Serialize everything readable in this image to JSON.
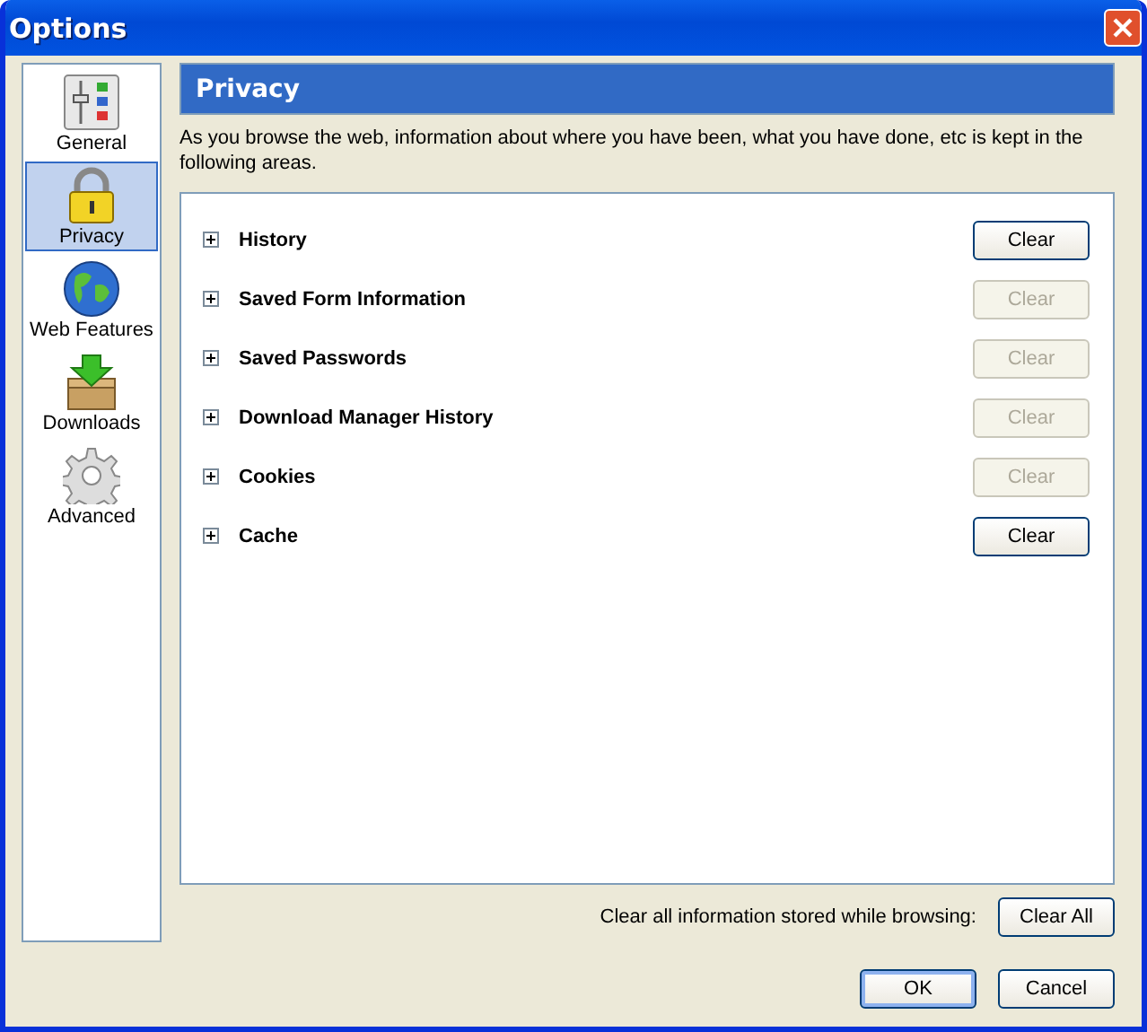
{
  "window": {
    "title": "Options"
  },
  "sidebar": {
    "items": [
      {
        "label": "General",
        "selected": false
      },
      {
        "label": "Privacy",
        "selected": true
      },
      {
        "label": "Web Features",
        "selected": false
      },
      {
        "label": "Downloads",
        "selected": false
      },
      {
        "label": "Advanced",
        "selected": false
      }
    ]
  },
  "panel": {
    "title": "Privacy",
    "description": "As you browse the web, information about where you have been, what you have done, etc is kept in the following areas.",
    "items": [
      {
        "label": "History",
        "expanded": false,
        "button": "Clear",
        "disabled": false
      },
      {
        "label": "Saved Form Information",
        "expanded": false,
        "button": "Clear",
        "disabled": true
      },
      {
        "label": "Saved Passwords",
        "expanded": false,
        "button": "Clear",
        "disabled": true
      },
      {
        "label": "Download Manager History",
        "expanded": false,
        "button": "Clear",
        "disabled": true
      },
      {
        "label": "Cookies",
        "expanded": false,
        "button": "Clear",
        "disabled": true
      },
      {
        "label": "Cache",
        "expanded": false,
        "button": "Clear",
        "disabled": false
      }
    ],
    "clear_all_label": "Clear all information stored while browsing:",
    "clear_all_button": "Clear All"
  },
  "buttons": [
    {
      "label": "OK",
      "default": true
    },
    {
      "label": "Cancel",
      "default": false
    }
  ]
}
